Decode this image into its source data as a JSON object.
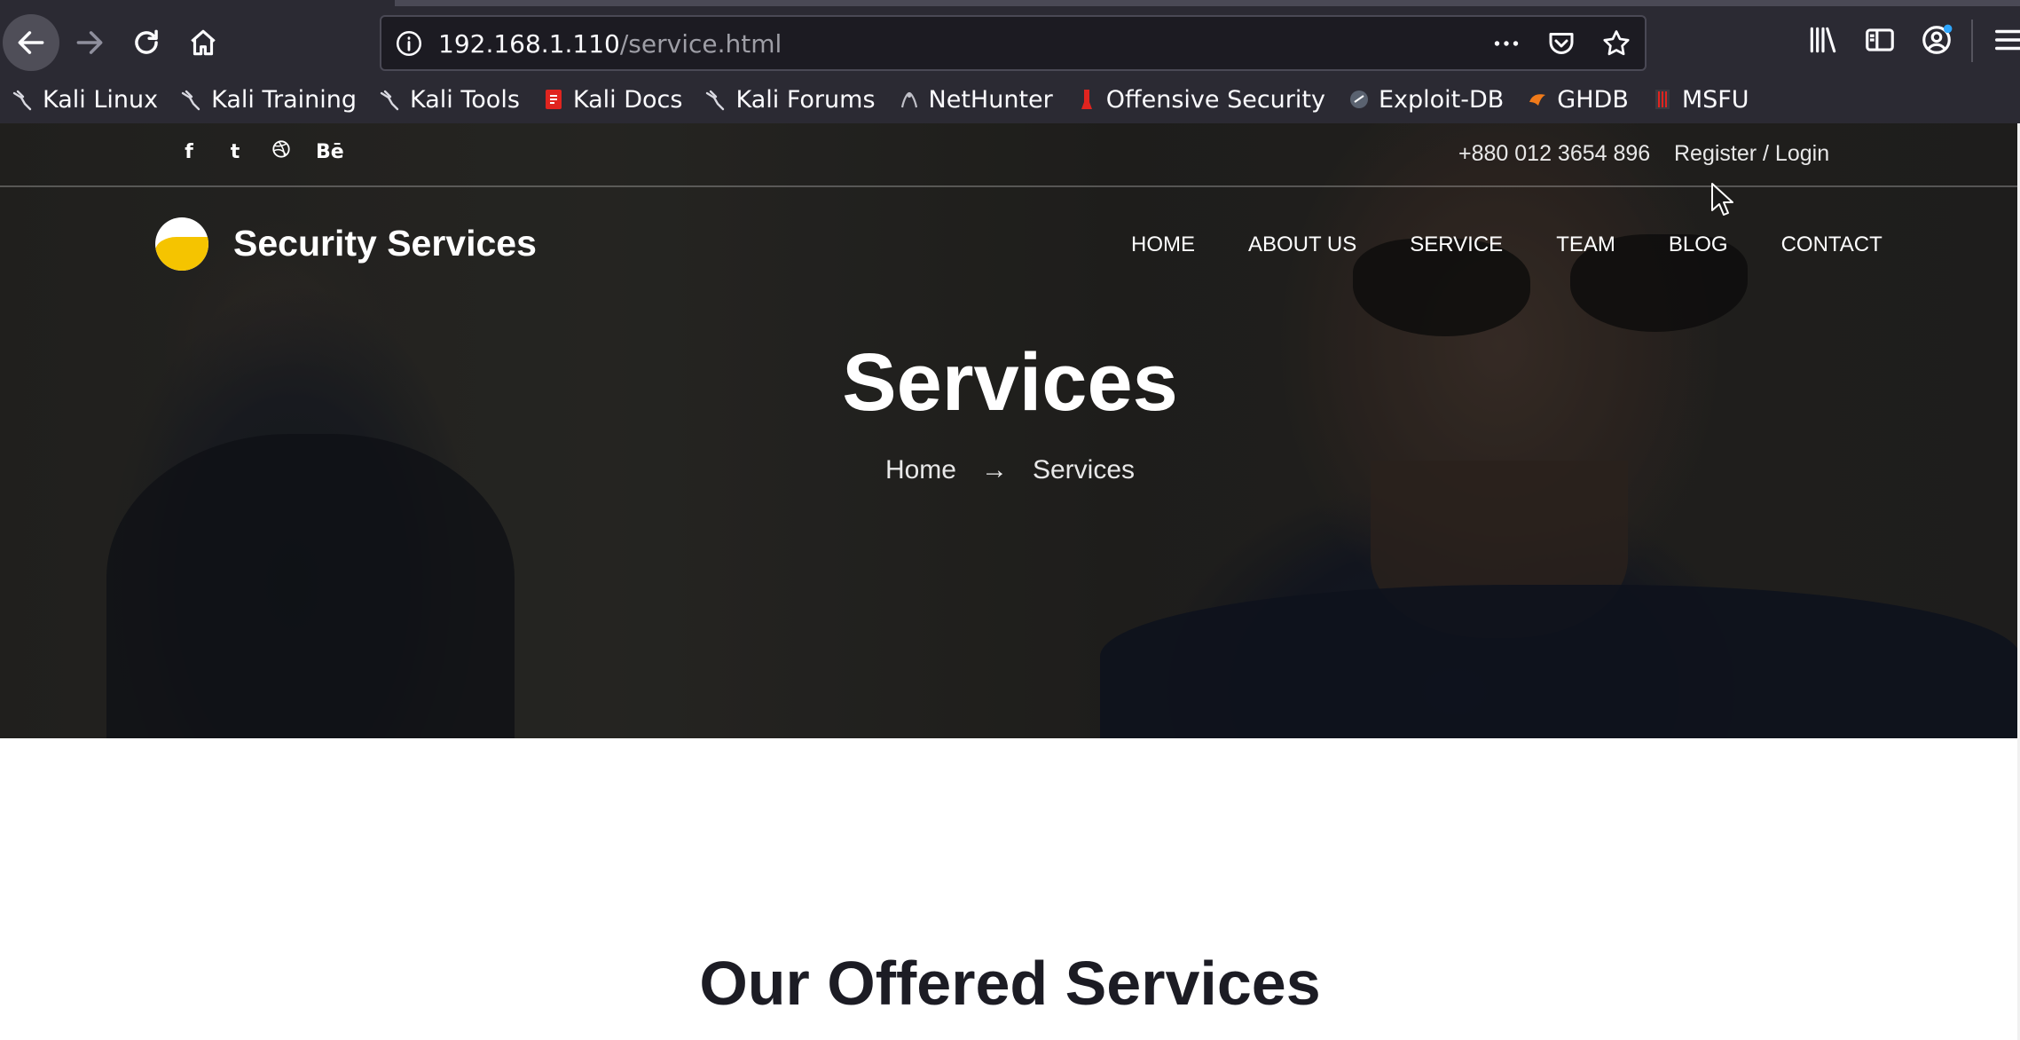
{
  "browser": {
    "url_host": "192.168.1.110",
    "url_path": "/service.html",
    "bookmarks": [
      {
        "label": "Kali Linux",
        "icon": "kali-dragon-icon"
      },
      {
        "label": "Kali Training",
        "icon": "kali-dragon-icon"
      },
      {
        "label": "Kali Tools",
        "icon": "kali-dragon-icon"
      },
      {
        "label": "Kali Docs",
        "icon": "kali-docs-icon"
      },
      {
        "label": "Kali Forums",
        "icon": "kali-dragon-icon"
      },
      {
        "label": "NetHunter",
        "icon": "nethunter-icon"
      },
      {
        "label": "Offensive Security",
        "icon": "offsec-icon"
      },
      {
        "label": "Exploit-DB",
        "icon": "exploit-db-icon"
      },
      {
        "label": "GHDB",
        "icon": "ghdb-icon"
      },
      {
        "label": "MSFU",
        "icon": "msfu-icon"
      }
    ]
  },
  "site": {
    "social": [
      "f",
      "t",
      "d",
      "Bē"
    ],
    "phone": "+880 012 3654 896",
    "login": "Register / Login",
    "brand": "Security Services",
    "menu": [
      "HOME",
      "ABOUT US",
      "SERVICE",
      "TEAM",
      "BLOG",
      "CONTACT"
    ],
    "hero_title": "Services",
    "breadcrumb_home": "Home",
    "breadcrumb_arrow": "→",
    "breadcrumb_current": "Services",
    "section_title": "Our Offered Services"
  },
  "colors": {
    "chrome_bg": "#2b2a33",
    "urlbar_bg": "#1c1b22",
    "logo_accent": "#f5c400"
  }
}
